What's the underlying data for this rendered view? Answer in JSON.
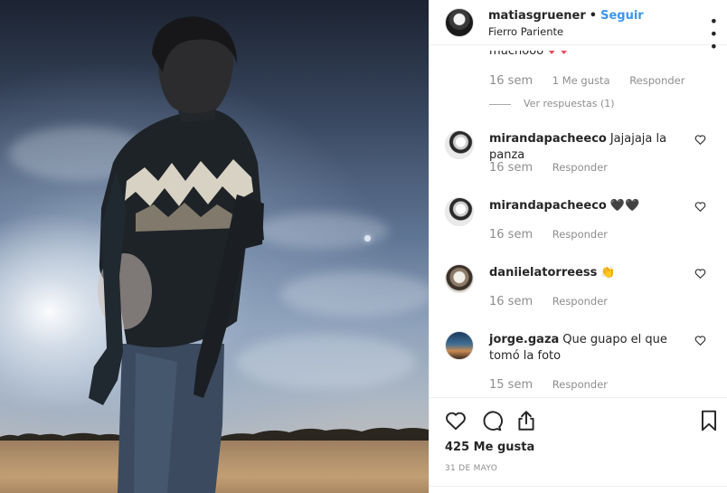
{
  "post": {
    "owner": "matiasgruener",
    "separator": "•",
    "follow_label": "Seguir",
    "location": "Fierro Pariente",
    "more_icon": "more-options-icon"
  },
  "previous_comment": {
    "text_fragment": "muchooo",
    "hearts": "♥ ♥",
    "time": "16 sem",
    "likes_label": "1 Me gusta",
    "reply_label": "Responder",
    "view_replies": "Ver respuestas (1)"
  },
  "comments": [
    {
      "user": "mirandapacheeco",
      "text": "Jajajaja la panza",
      "time": "16 sem",
      "reply_label": "Responder"
    },
    {
      "user": "mirandapacheeco",
      "text": "🖤🖤",
      "time": "16 sem",
      "reply_label": "Responder"
    },
    {
      "user": "daniielatorreess",
      "text": "👏",
      "time": "16 sem",
      "reply_label": "Responder"
    },
    {
      "user": "jorge.gaza",
      "text": "Que guapo el que tomó la foto",
      "time": "15 sem",
      "reply_label": "Responder"
    }
  ],
  "actions": {
    "like_icon": "heart-outline-icon",
    "comment_icon": "comment-bubble-icon",
    "share_icon": "share-upload-icon",
    "save_icon": "bookmark-icon",
    "likes_count": "425 Me gusta",
    "date": "31 DE MAYO"
  },
  "colors": {
    "follow_blue": "#3897f0",
    "muted_text": "#8e8e8e",
    "primary_text": "#262626",
    "divider": "#efefef"
  }
}
